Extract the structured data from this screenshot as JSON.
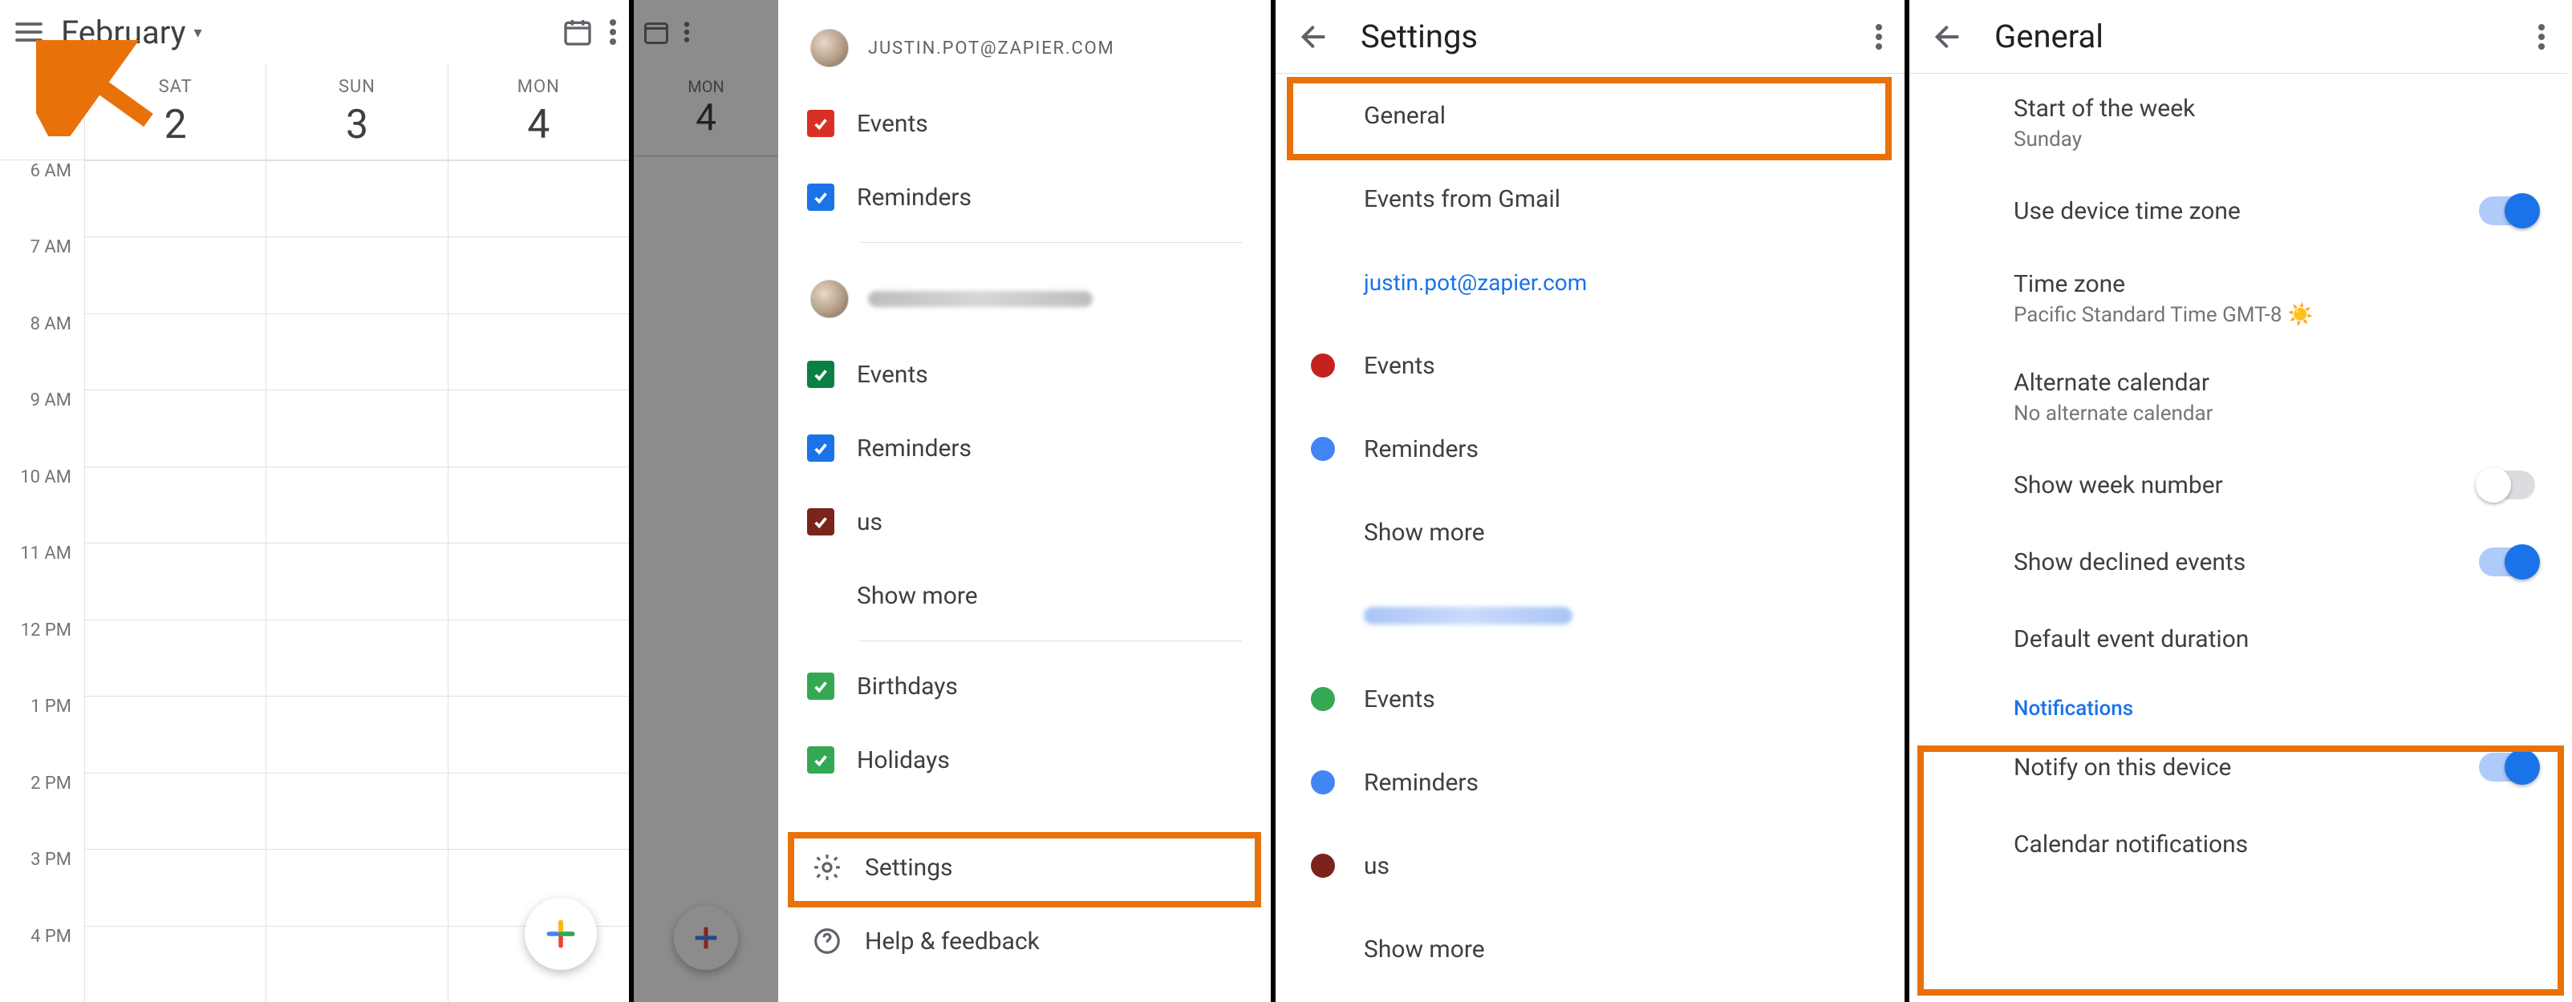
{
  "pane1": {
    "month": "February",
    "days": [
      {
        "dow": "SAT",
        "num": "2"
      },
      {
        "dow": "SUN",
        "num": "3"
      },
      {
        "dow": "MON",
        "num": "4"
      }
    ],
    "times": [
      "6 AM",
      "7 AM",
      "8 AM",
      "9 AM",
      "10 AM",
      "11 AM",
      "12 PM",
      "1 PM",
      "2 PM",
      "3 PM",
      "4 PM"
    ]
  },
  "pane2": {
    "account1_email": "JUSTIN.POT@ZAPIER.COM",
    "account1_items": [
      {
        "label": "Events",
        "color": "cb-red"
      },
      {
        "label": "Reminders",
        "color": "cb-blue"
      }
    ],
    "account2_items": [
      {
        "label": "Events",
        "color": "cb-teal"
      },
      {
        "label": "Reminders",
        "color": "cb-blue"
      },
      {
        "label": "us",
        "color": "cb-dkred"
      }
    ],
    "show_more": "Show more",
    "extras": [
      {
        "label": "Birthdays",
        "color": "cb-green2"
      },
      {
        "label": "Holidays",
        "color": "cb-green2"
      }
    ],
    "settings_label": "Settings",
    "help_label": "Help & feedback",
    "peek_day": {
      "dow": "MON",
      "num": "4"
    }
  },
  "pane3": {
    "title": "Settings",
    "rows_top": [
      {
        "label": "General"
      },
      {
        "label": "Events from Gmail"
      }
    ],
    "account1_link": "justin.pot@zapier.com",
    "account1_cals": [
      {
        "label": "Events",
        "dot": "dot-red"
      },
      {
        "label": "Reminders",
        "dot": "dot-blue"
      }
    ],
    "show_more": "Show more",
    "account2_cals": [
      {
        "label": "Events",
        "dot": "dot-green"
      },
      {
        "label": "Reminders",
        "dot": "dot-blue"
      },
      {
        "label": "us",
        "dot": "dot-maroon"
      }
    ]
  },
  "pane4": {
    "title": "General",
    "prefs": [
      {
        "title": "Start of the week",
        "sub": "Sunday"
      },
      {
        "title": "Use device time zone",
        "toggle": "on"
      },
      {
        "title": "Time zone",
        "sub": "Pacific Standard Time  GMT-8 ☀️"
      },
      {
        "title": "Alternate calendar",
        "sub": "No alternate calendar"
      },
      {
        "title": "Show week number",
        "toggle": "off"
      },
      {
        "title": "Show declined events",
        "toggle": "on"
      },
      {
        "title": "Default event duration"
      }
    ],
    "notifications_header": "Notifications",
    "notif_prefs": [
      {
        "title": "Notify on this device",
        "toggle": "on"
      },
      {
        "title": "Calendar notifications"
      }
    ]
  }
}
